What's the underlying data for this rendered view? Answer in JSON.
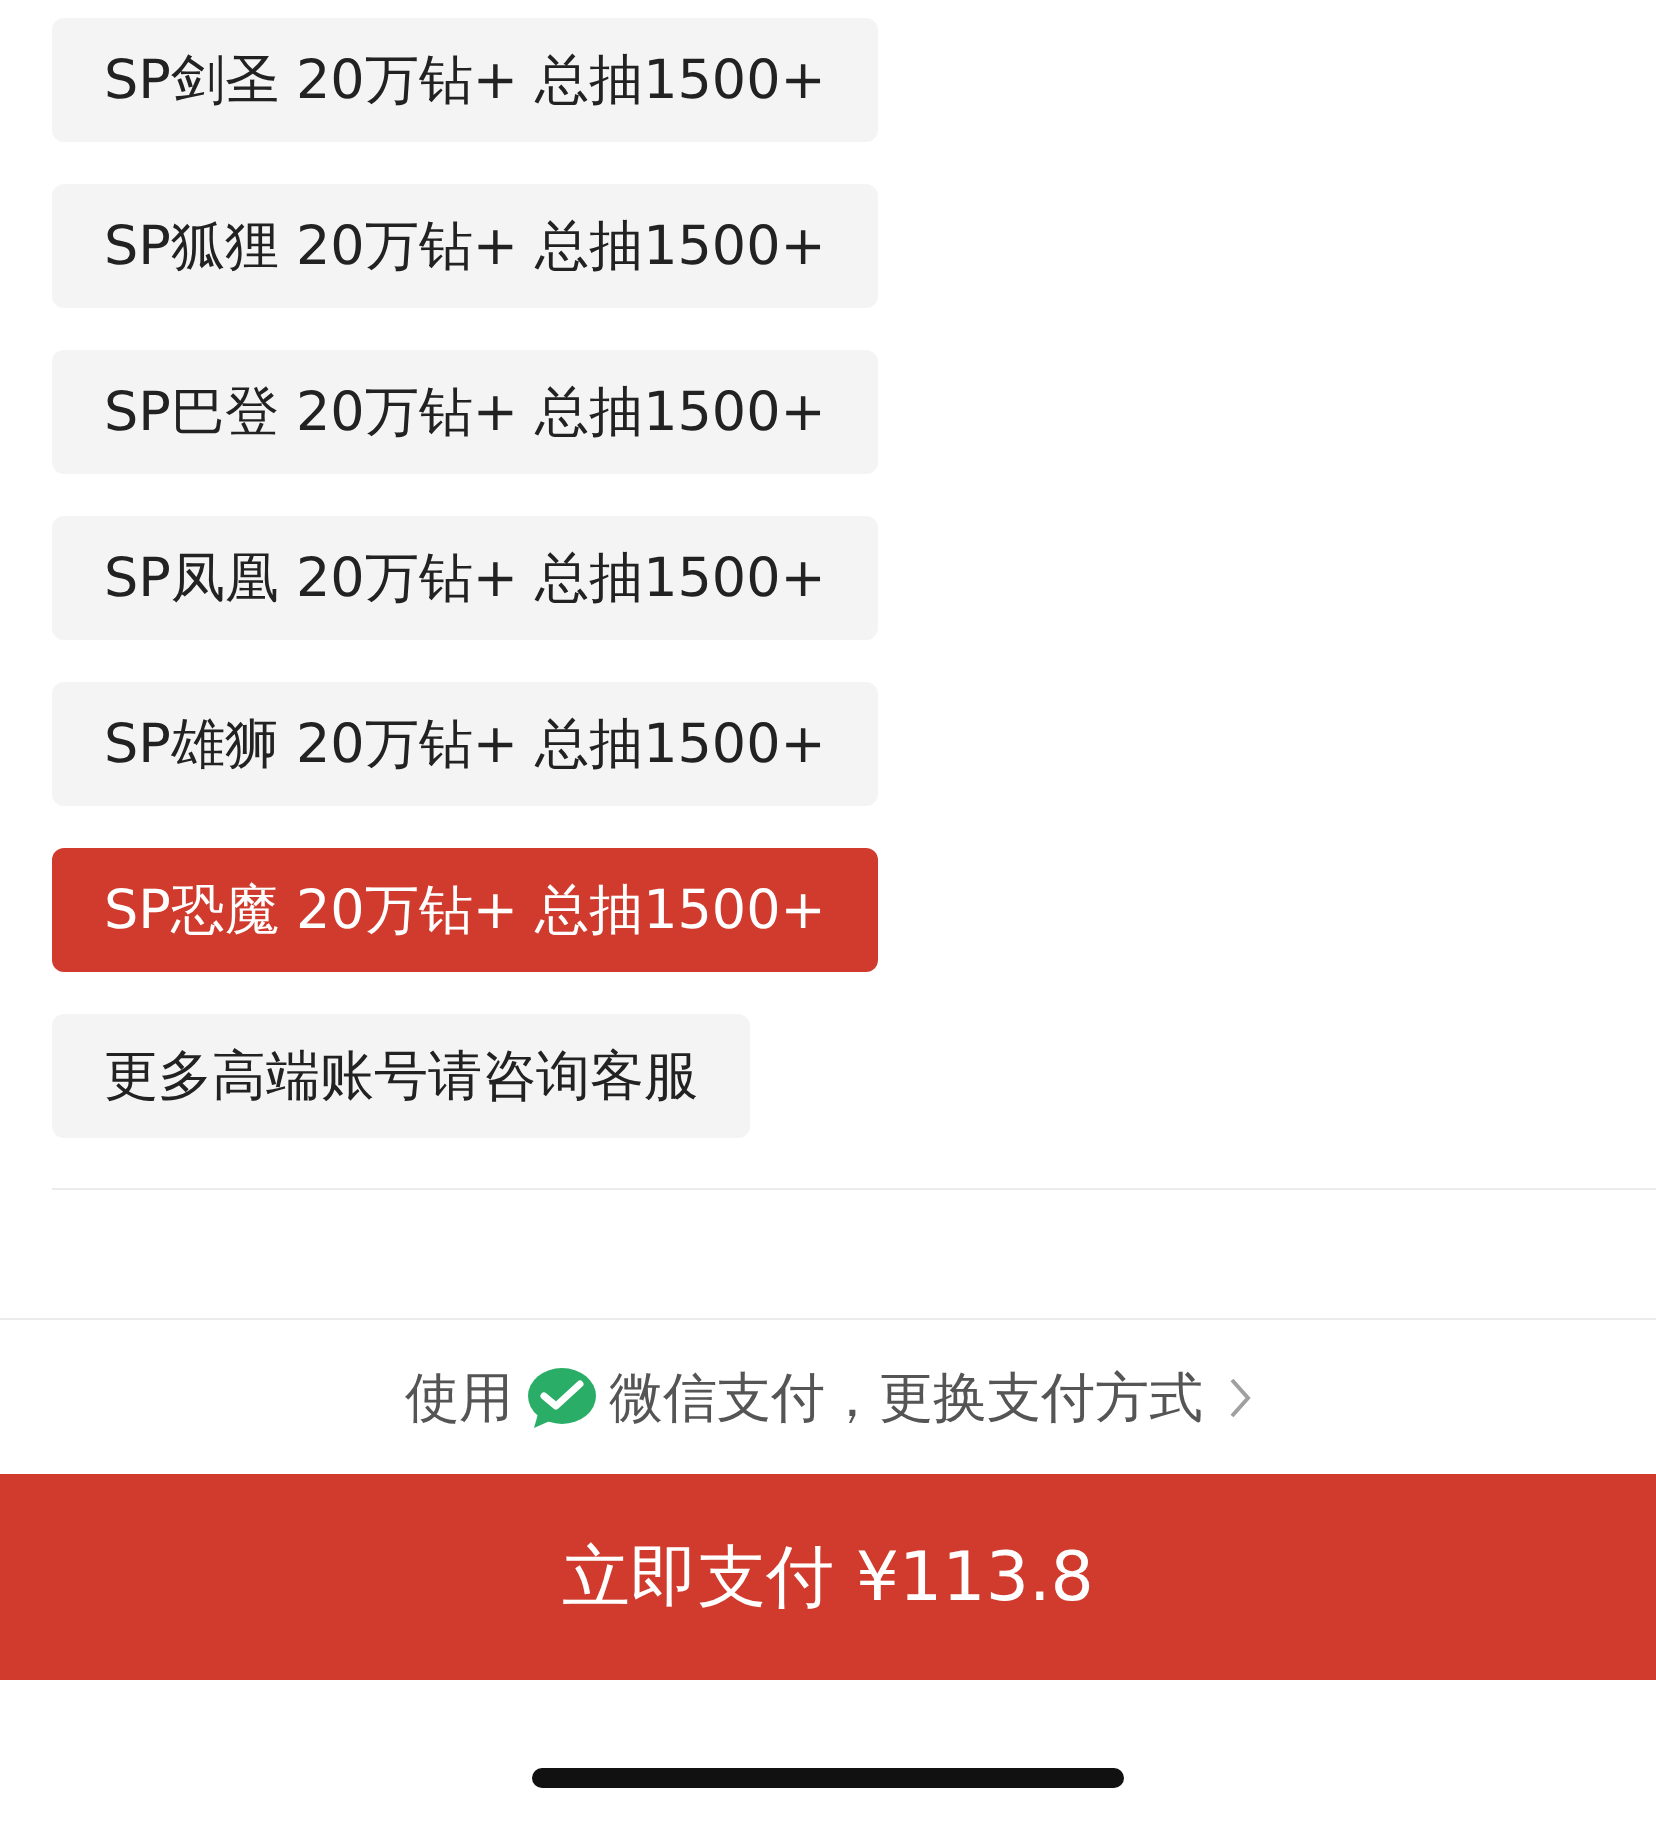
{
  "options": [
    {
      "label": "SP剑圣 20万钻+ 总抽1500+",
      "selected": false
    },
    {
      "label": "SP狐狸 20万钻+ 总抽1500+",
      "selected": false
    },
    {
      "label": "SP巴登 20万钻+ 总抽1500+",
      "selected": false
    },
    {
      "label": "SP凤凰 20万钻+ 总抽1500+",
      "selected": false
    },
    {
      "label": "SP雄狮 20万钻+ 总抽1500+",
      "selected": false
    },
    {
      "label": "SP恐魔 20万钻+ 总抽1500+",
      "selected": true
    },
    {
      "label": "更多高端账号请咨询客服",
      "selected": false
    }
  ],
  "payment": {
    "prefix": "使用",
    "method": "微信支付，更换支付方式"
  },
  "pay_button": "立即支付 ¥113.8"
}
